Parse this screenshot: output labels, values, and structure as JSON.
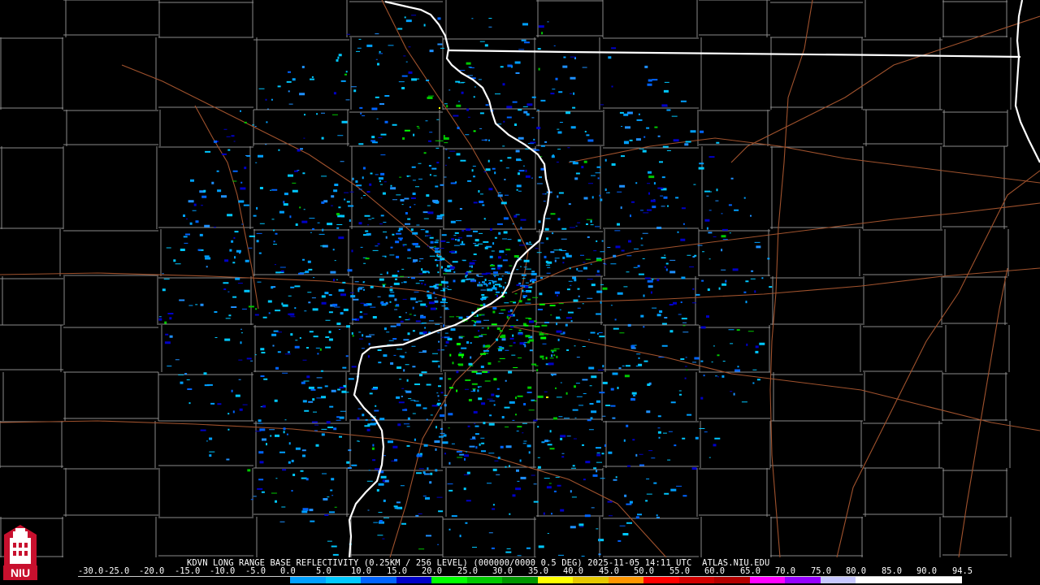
{
  "product": {
    "title": "KDVN LONG RANGE BASE REFLECTIVITY (0.25KM / 256 LEVEL) (000000/0000 0.5 DEG) 2025-11-05 14:11 UTC  ATLAS.NIU.EDU"
  },
  "logo": {
    "text": "NIU",
    "icon": "niu-tower-logo-icon",
    "color": "#c8102e"
  },
  "colors": {
    "background": "#000000",
    "county_line": "#8a8a8a",
    "state_line": "#ffffff",
    "highway": "#a0522d"
  },
  "scale": {
    "labels": [
      "-30.0",
      "-25.0",
      "-20.0",
      "-15.0",
      "-10.0",
      "-5.0",
      "0.0",
      "5.0",
      "10.0",
      "15.0",
      "20.0",
      "25.0",
      "30.0",
      "35.0",
      "40.0",
      "45.0",
      "50.0",
      "55.0",
      "60.0",
      "65.0",
      "70.0",
      "75.0",
      "80.0",
      "85.0",
      "90.0",
      "94.5"
    ],
    "colors": [
      "#000000",
      "#000000",
      "#000000",
      "#000000",
      "#000000",
      "#000000",
      "#00a0ff",
      "#00c8ff",
      "#0064ff",
      "#0000c8",
      "#00ff00",
      "#00c800",
      "#009600",
      "#ffff00",
      "#e6c800",
      "#ff9600",
      "#ff0000",
      "#d20000",
      "#b40000",
      "#ff00ff",
      "#9600ff",
      "#c8c8ff",
      "#ffffff",
      "#ffffff",
      "#ffffff"
    ]
  }
}
